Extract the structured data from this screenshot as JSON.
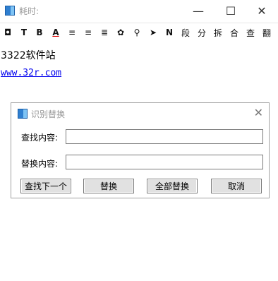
{
  "window": {
    "title": "耗时:",
    "minimize_glyph": "—",
    "maximize_glyph": "☐",
    "close_glyph": "✕"
  },
  "toolbar": {
    "items": [
      {
        "name": "border-icon",
        "glyph": "◘"
      },
      {
        "name": "text-t-icon",
        "glyph": "T"
      },
      {
        "name": "bold-icon",
        "glyph": "B"
      },
      {
        "name": "font-color-icon",
        "glyph": "A"
      },
      {
        "name": "align-left-icon",
        "glyph": "≡"
      },
      {
        "name": "align-center-icon",
        "glyph": "≡"
      },
      {
        "name": "align-justify-icon",
        "glyph": "≣"
      },
      {
        "name": "palette-icon",
        "glyph": "✿"
      },
      {
        "name": "search-icon",
        "glyph": "⚲"
      },
      {
        "name": "send-icon",
        "glyph": "➤"
      },
      {
        "name": "n-icon",
        "glyph": "N"
      },
      {
        "name": "paragraph-button",
        "glyph": "段"
      },
      {
        "name": "split-button",
        "glyph": "分"
      },
      {
        "name": "break-button",
        "glyph": "拆"
      },
      {
        "name": "merge-button",
        "glyph": "合"
      },
      {
        "name": "find-button",
        "glyph": "查"
      },
      {
        "name": "translate-button",
        "glyph": "翻"
      }
    ]
  },
  "content": {
    "line1": "3322软件站",
    "line2": "www.32r.com"
  },
  "dialog": {
    "title": "识别替换",
    "close_glyph": "✕",
    "find_label": "查找内容:",
    "find_value": "",
    "replace_label": "替换内容:",
    "replace_value": "",
    "buttons": {
      "find_next": "查找下一个",
      "replace": "替换",
      "replace_all": "全部替换",
      "cancel": "取消"
    }
  },
  "colors": {
    "title_text": "#999999",
    "link": "#0000ee",
    "button_bg": "#e1e1e1",
    "icon_blue": "#2f7fd0"
  }
}
